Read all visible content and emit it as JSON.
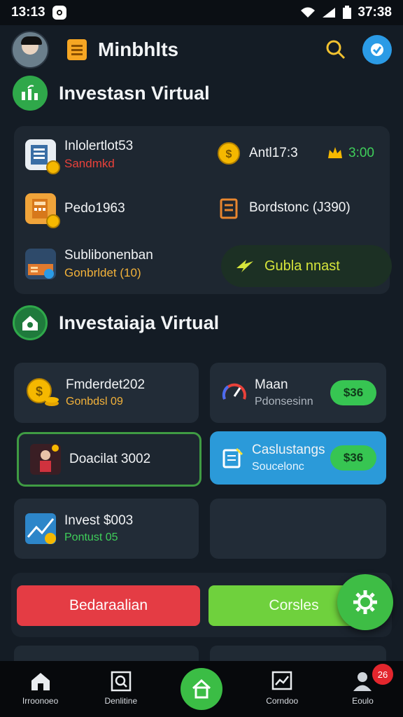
{
  "status_bar": {
    "time": "13:13",
    "clock_right": "37:38"
  },
  "header": {
    "title": "Minbhlts"
  },
  "section1": {
    "title": "Investasn Virtual",
    "items": [
      {
        "label": "Inlolertlot53",
        "sub": "Sandmkd"
      },
      {
        "label": "Antl17:3",
        "value": "3:00"
      },
      {
        "label": "Pedo1963"
      },
      {
        "label": "Bordstonc (J390)"
      },
      {
        "label": "Sublibonenban",
        "sub": "Gonbrldet (10)"
      }
    ],
    "chip_label": "Gubla nnast"
  },
  "section2": {
    "title": "Investaiaja Virtual",
    "cards": [
      {
        "title": "Fmderdet202",
        "sub": "Gonbdsl 09"
      },
      {
        "title": "Maan",
        "sub": "Pdonsesinn",
        "price": "$36"
      },
      {
        "title": "Doacilat 3002"
      },
      {
        "title": "Caslustangs",
        "sub": "Soucelonc",
        "price": "$36"
      },
      {
        "title": "Invest $003",
        "sub": "Pontust 05"
      }
    ]
  },
  "actions": {
    "primary": "Bedaraalian",
    "secondary": "Corsles"
  },
  "bottom_nav": {
    "items": [
      "Irroonoeo",
      "Denlitine",
      "Corndoo",
      "Eoulo"
    ],
    "badge": "26"
  },
  "colors": {
    "accent_green": "#3ebd45",
    "danger_red": "#e43c44",
    "info_blue": "#2b9ad9"
  }
}
